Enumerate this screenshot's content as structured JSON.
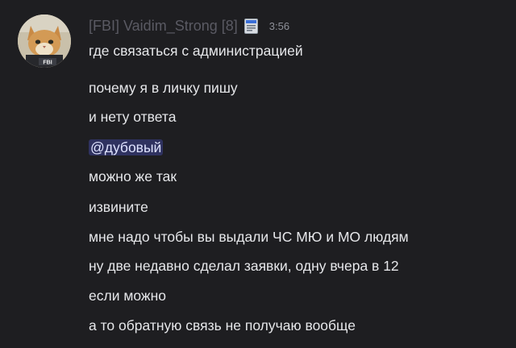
{
  "message": {
    "author": "[FBI] Vaidim_Strong [8]",
    "role_icon": "fbi-badge-icon",
    "timestamp": "3:56",
    "avatar_badge_text": "FBI",
    "lines": [
      "где связаться с администрацией",
      "почему я в личку пишу",
      "и нету ответа",
      "@дубовый",
      "можно же так",
      "извините",
      "мне надо чтобы вы выдали ЧС МЮ и МО людям",
      "ну две недавно сделал заявки, одну вчера в 12",
      "если можно",
      "а то обратную связь не получаю вообще"
    ]
  },
  "colors": {
    "background": "#1e1e21",
    "text": "#e6e7ea",
    "username": "#5a5a63",
    "timestamp": "#8e9099",
    "mention_bg": "#5865f2"
  }
}
